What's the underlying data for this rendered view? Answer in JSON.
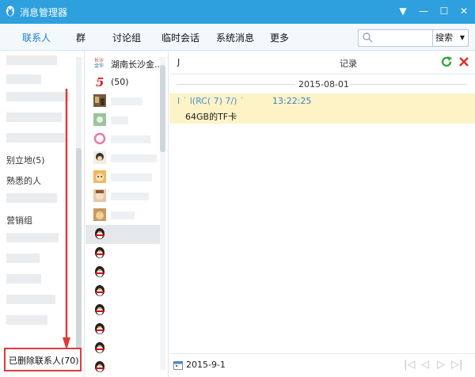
{
  "window": {
    "title": "消息管理器",
    "controls": [
      "minimize",
      "maximize",
      "close"
    ],
    "dropdown_glyph": "▼",
    "min_glyph": "—",
    "max_glyph": "☐",
    "close_glyph": "✕"
  },
  "tabs": [
    {
      "label": "联系人",
      "active": true
    },
    {
      "label": "群"
    },
    {
      "label": "讨论组"
    },
    {
      "label": "临时会话"
    },
    {
      "label": "系统消息"
    },
    {
      "label": "更多"
    }
  ],
  "search": {
    "placeholder": "",
    "button_label": "搜索",
    "arrow": "▼"
  },
  "groups": {
    "partial_labels": [
      "别立地(5)",
      "熟悉的人",
      "营销组"
    ],
    "deleted_label": "已删除联系人(70)"
  },
  "contacts": [
    {
      "name": "湖南长沙金...",
      "avatar": "logo-avatar-icon"
    },
    {
      "name": "(50)",
      "avatar": "number-five-avatar-icon"
    },
    {
      "name": "",
      "avatar": "photo-avatar-icon"
    },
    {
      "name": "",
      "avatar": "photo-avatar-icon"
    },
    {
      "name": "",
      "avatar": "photo-avatar-icon"
    },
    {
      "name": "",
      "avatar": "photo-avatar-icon"
    },
    {
      "name": "",
      "avatar": "photo-avatar-icon"
    },
    {
      "name": "",
      "avatar": "photo-avatar-icon"
    },
    {
      "name": "",
      "avatar": "photo-avatar-icon"
    },
    {
      "name": "",
      "avatar": "penguin-avatar-icon"
    },
    {
      "name": "",
      "avatar": "penguin-avatar-icon"
    },
    {
      "name": "",
      "avatar": "penguin-avatar-icon"
    },
    {
      "name": "",
      "avatar": "penguin-avatar-icon"
    },
    {
      "name": "",
      "avatar": "penguin-avatar-icon"
    },
    {
      "name": "",
      "avatar": "penguin-avatar-icon"
    },
    {
      "name": "",
      "avatar": "penguin-avatar-icon"
    },
    {
      "name": "",
      "avatar": "penguin-avatar-icon"
    }
  ],
  "message_panel": {
    "header_who": "J",
    "header_record": "记录",
    "date_separator": "2015-08-01",
    "message": {
      "sender": "I ˙ l(RC( 7) 7/) ˙",
      "time": "13:22:25",
      "body": "64GB的TF卡"
    },
    "footer_date": "2015-9-1",
    "pager": [
      "|◁",
      "◁",
      "▷",
      "▷|"
    ]
  },
  "colors": {
    "titlebar": "#2ea0dd",
    "accent": "#1d7fc8",
    "message_bg": "#fdf3c7",
    "highlight_red": "#e03a3a"
  }
}
